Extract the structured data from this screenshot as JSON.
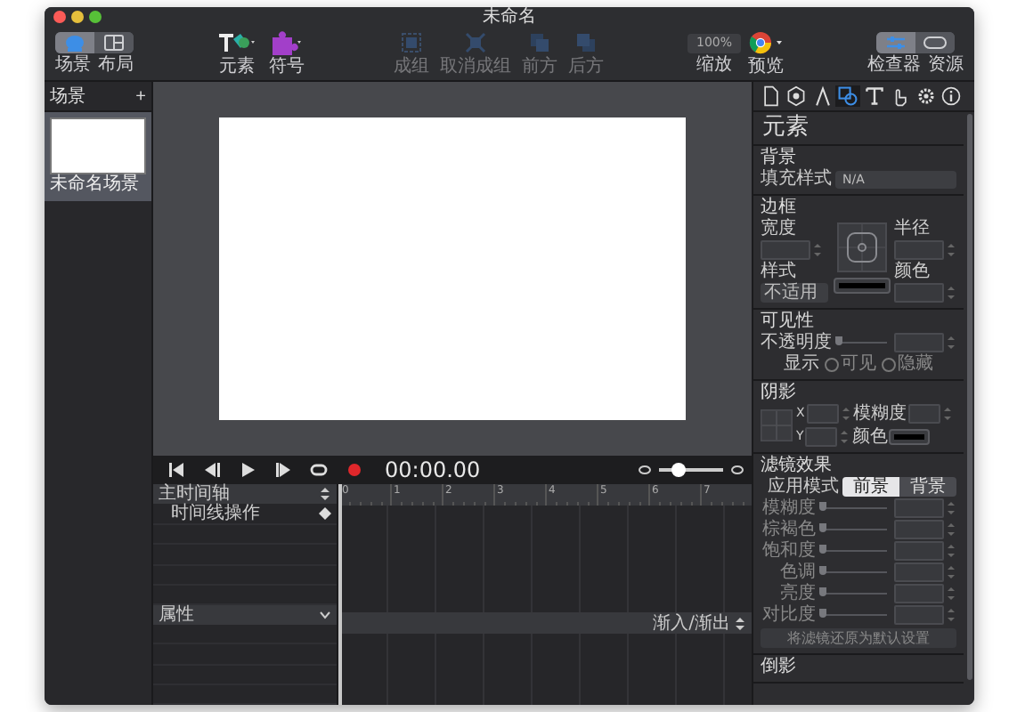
{
  "window": {
    "title": "未命名"
  },
  "toolbar": {
    "view_switch": [
      {
        "kind": "scene",
        "label": "场景",
        "selected": true
      },
      {
        "kind": "layout",
        "label": "布局",
        "selected": false
      }
    ],
    "insert": [
      {
        "kind": "elements",
        "label": "元素"
      },
      {
        "kind": "symbols",
        "label": "符号"
      }
    ],
    "arrange": [
      {
        "kind": "group",
        "label": "成组",
        "disabled": true
      },
      {
        "kind": "ungroup",
        "label": "取消成组",
        "disabled": true
      },
      {
        "kind": "front",
        "label": "前方",
        "disabled": true
      },
      {
        "kind": "back",
        "label": "后方",
        "disabled": true
      }
    ],
    "zoom": {
      "value": "100%",
      "label": "缩放"
    },
    "preview": {
      "label": "预览"
    },
    "panels": [
      {
        "kind": "inspector",
        "label": "检查器",
        "selected": true
      },
      {
        "kind": "resources",
        "label": "资源",
        "selected": false
      }
    ]
  },
  "scenes": {
    "title": "场景",
    "add": "+",
    "items": [
      {
        "name": "未命名场景",
        "selected": true
      }
    ]
  },
  "transport": {
    "buttons": [
      {
        "kind": "start"
      },
      {
        "kind": "back"
      },
      {
        "kind": "play"
      },
      {
        "kind": "forward"
      },
      {
        "kind": "loop"
      },
      {
        "kind": "record"
      }
    ],
    "time": "00:00.00",
    "timeline_zoom": {
      "level": 0.3
    }
  },
  "timeline": {
    "title": "主时间轴",
    "rows": [
      "时间线操作"
    ],
    "ruler": [
      "0",
      "1",
      "2",
      "3",
      "4",
      "5",
      "6",
      "7"
    ],
    "properties": "属性",
    "easing": "渐入/渐出"
  },
  "inspector": {
    "tabs": [
      {
        "kind": "page",
        "selected": false
      },
      {
        "kind": "hexagon",
        "selected": false
      },
      {
        "kind": "compass",
        "selected": false
      },
      {
        "kind": "shapes",
        "selected": true
      },
      {
        "kind": "text",
        "selected": false
      },
      {
        "kind": "hand",
        "selected": false
      },
      {
        "kind": "gear",
        "selected": false
      },
      {
        "kind": "info",
        "selected": false
      }
    ],
    "heading": "元素",
    "background": {
      "title": "背景",
      "fill_label": "填充样式",
      "fill_value": "N/A"
    },
    "border": {
      "title": "边框",
      "width_label": "宽度",
      "radius_label": "半径",
      "style_label": "样式",
      "style_value": "不适用",
      "color_label": "颜色"
    },
    "visibility": {
      "title": "可见性",
      "opacity_label": "不透明度",
      "opacity": {
        "level": 0
      },
      "display_label": "显示",
      "options": [
        {
          "label": "可见",
          "selected": false
        },
        {
          "label": "隐藏",
          "selected": false
        }
      ]
    },
    "shadow": {
      "title": "阴影",
      "x_label": "X",
      "y_label": "Y",
      "blur_label": "模糊度",
      "color_label": "颜色"
    },
    "filters": {
      "title": "滤镜效果",
      "mode_label": "应用模式",
      "modes": [
        {
          "label": "前景",
          "selected": true
        },
        {
          "label": "背景",
          "selected": false
        }
      ],
      "sliders": [
        {
          "label": "模糊度",
          "level": 0
        },
        {
          "label": "棕褐色",
          "level": 0
        },
        {
          "label": "饱和度",
          "level": 0
        },
        {
          "label": "色调",
          "level": 0
        },
        {
          "label": "亮度",
          "level": 0
        },
        {
          "label": "对比度",
          "level": 0
        }
      ],
      "reset": "将滤镜还原为默认设置"
    },
    "reflection": {
      "title": "倒影"
    }
  }
}
